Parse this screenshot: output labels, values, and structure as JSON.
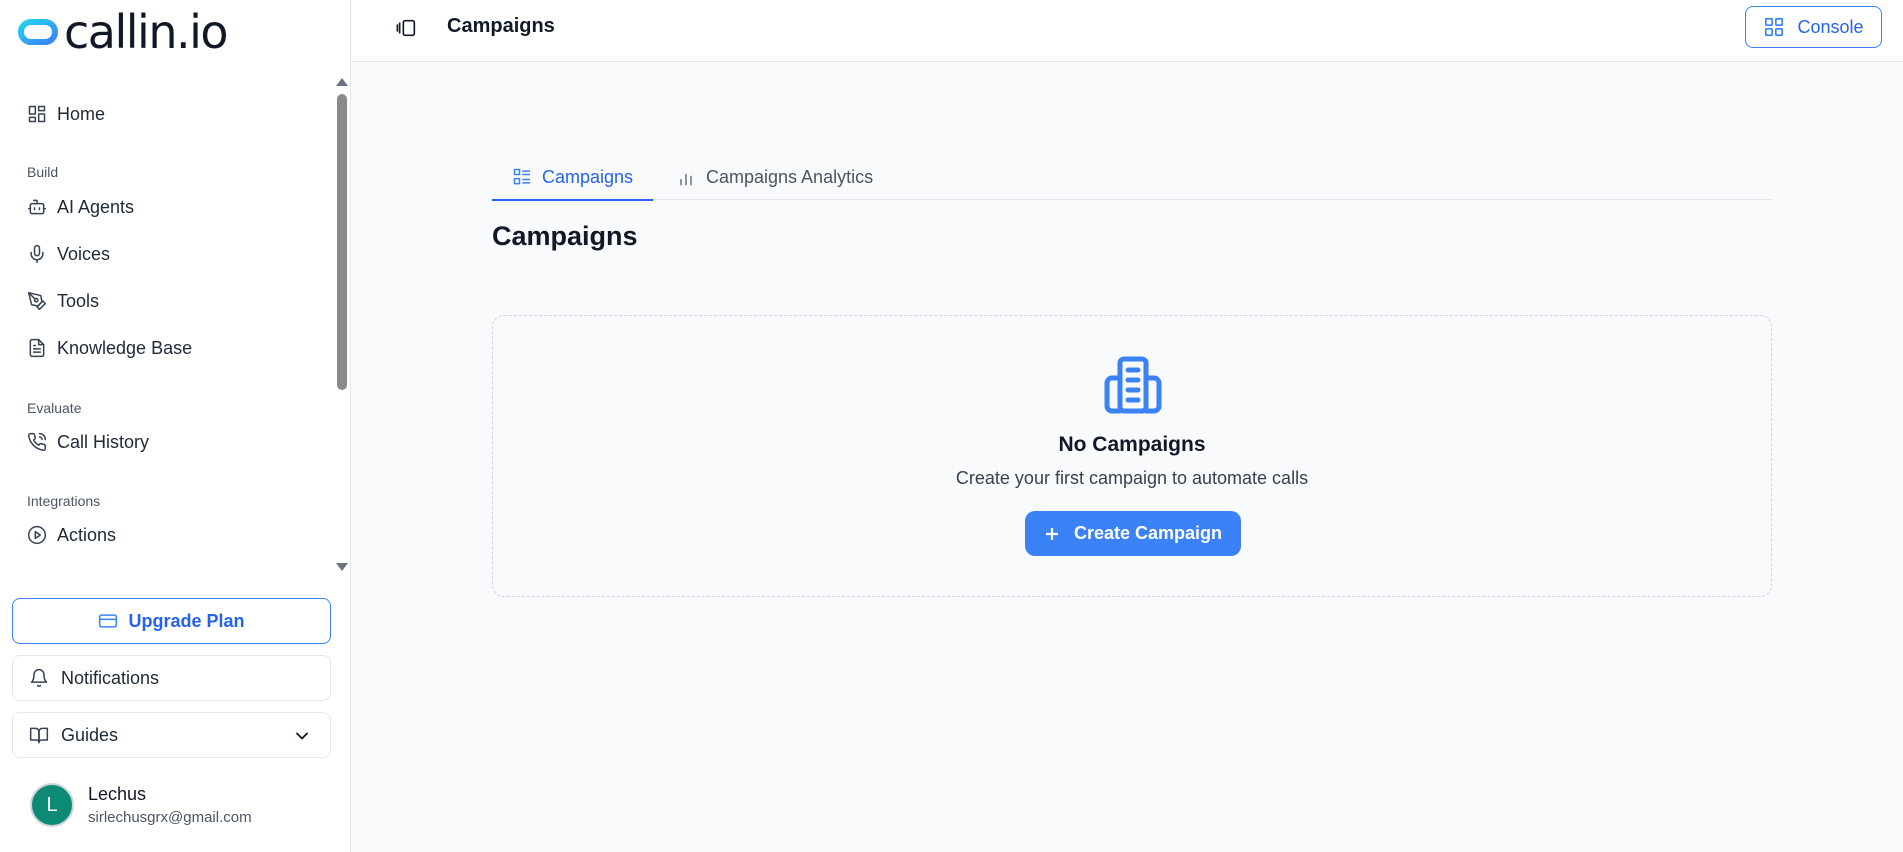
{
  "app": {
    "logo_text": "callin.io",
    "brand_color": "#3b82f6",
    "logo_colors": [
      "#22d3ee",
      "#3b82f6"
    ]
  },
  "sidebar": {
    "items": [
      {
        "label": "Home",
        "icon": "grid-icon"
      },
      {
        "label": "AI Agents",
        "icon": "bot-icon"
      },
      {
        "label": "Voices",
        "icon": "mic-icon"
      },
      {
        "label": "Tools",
        "icon": "pen-tool-icon"
      },
      {
        "label": "Knowledge Base",
        "icon": "document-icon"
      },
      {
        "label": "Call History",
        "icon": "phone-icon"
      },
      {
        "label": "Actions",
        "icon": "play-circle-icon"
      }
    ],
    "sections": {
      "build": "Build",
      "evaluate": "Evaluate",
      "integrations": "Integrations"
    },
    "upgrade_label": "Upgrade Plan",
    "notifications_label": "Notifications",
    "guides_label": "Guides",
    "user": {
      "initial": "L",
      "name": "Lechus",
      "email": "sirlechusgrx@gmail.com",
      "avatar_color": "#0d8a74"
    }
  },
  "header": {
    "title": "Campaigns",
    "console_label": "Console"
  },
  "main": {
    "tabs": [
      {
        "label": "Campaigns",
        "active": true
      },
      {
        "label": "Campaigns Analytics",
        "active": false
      }
    ],
    "page_title": "Campaigns",
    "empty_state": {
      "title": "No Campaigns",
      "subtitle": "Create your first campaign to automate calls",
      "button_label": "Create Campaign"
    }
  }
}
